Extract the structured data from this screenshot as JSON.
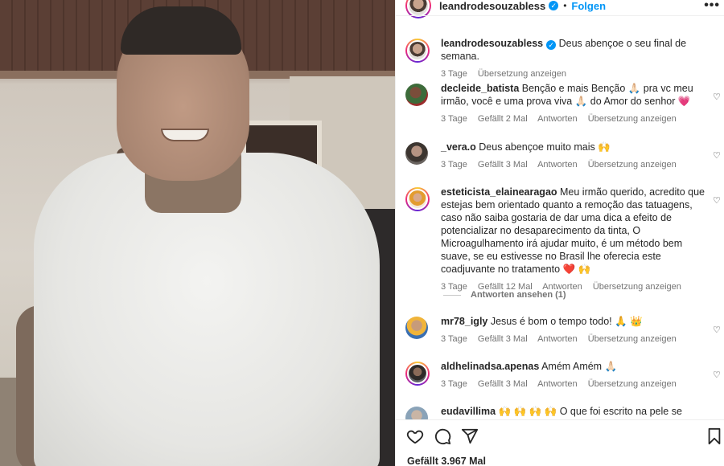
{
  "post": {
    "author": "leandrodesouzabless",
    "follow_label": "Folgen",
    "more_glyph": "•••",
    "verified_glyph": "✓",
    "caption": "Deus abençoe o seu final de semana.",
    "caption_time": "3 Tage",
    "caption_translate": "Übersetzung anzeigen",
    "likes_label": "Gefällt 3.967 Mal"
  },
  "comments": [
    {
      "user": "decleide_batista",
      "text": "Benção e mais Benção 🙏🏻 pra vc meu irmão, você e uma prova viva 🙏🏻 do Amor do senhor 💗",
      "time": "3 Tage",
      "likes": "Gefällt 2 Mal",
      "reply": "Antworten",
      "translate": "Übersetzung anzeigen"
    },
    {
      "user": "_vera.o",
      "text": "Deus abençoe muito mais 🙌",
      "time": "3 Tage",
      "likes": "Gefällt 3 Mal",
      "reply": "Antworten",
      "translate": "Übersetzung anzeigen"
    },
    {
      "user": "esteticista_elainearagao",
      "text": "Meu irmão querido, acredito que estejas bem orientado quanto a remoção das tatuagens, caso não saiba gostaria de dar uma dica a efeito de potencializar no desaparecimento da tinta, O Microagulhamento irá ajudar muito, é um método bem suave, se eu estivesse no Brasil lhe oferecia este coadjuvante no tratamento ❤️ 🙌",
      "time": "3 Tage",
      "likes": "Gefällt 12 Mal",
      "reply": "Antworten",
      "translate": "Übersetzung anzeigen",
      "view_replies": "Antworten ansehen (1)"
    },
    {
      "user": "mr78_igly",
      "text": "Jesus é bom o tempo todo! 🙏 👑",
      "time": "3 Tage",
      "likes": "Gefällt 3 Mal",
      "reply": "Antworten",
      "translate": "Übersetzung anzeigen"
    },
    {
      "user": "aldhelinadsa.apenas",
      "text": "Amém Amém 🙏🏻",
      "time": "3 Tage",
      "likes": "Gefällt 3 Mal",
      "reply": "Antworten",
      "translate": "Übersetzung anzeigen"
    },
    {
      "user": "eudavillima",
      "text": "🙌 🙌 🙌 🙌 O que foi escrito na pele se apaga,"
    }
  ],
  "icons": {
    "like": "heart-icon",
    "comment": "comment-icon",
    "share": "share-icon",
    "save": "bookmark-icon",
    "comment_like": "heart-outline-icon"
  },
  "colors": {
    "accent": "#0095f6",
    "muted": "#737373",
    "text": "#262626"
  }
}
